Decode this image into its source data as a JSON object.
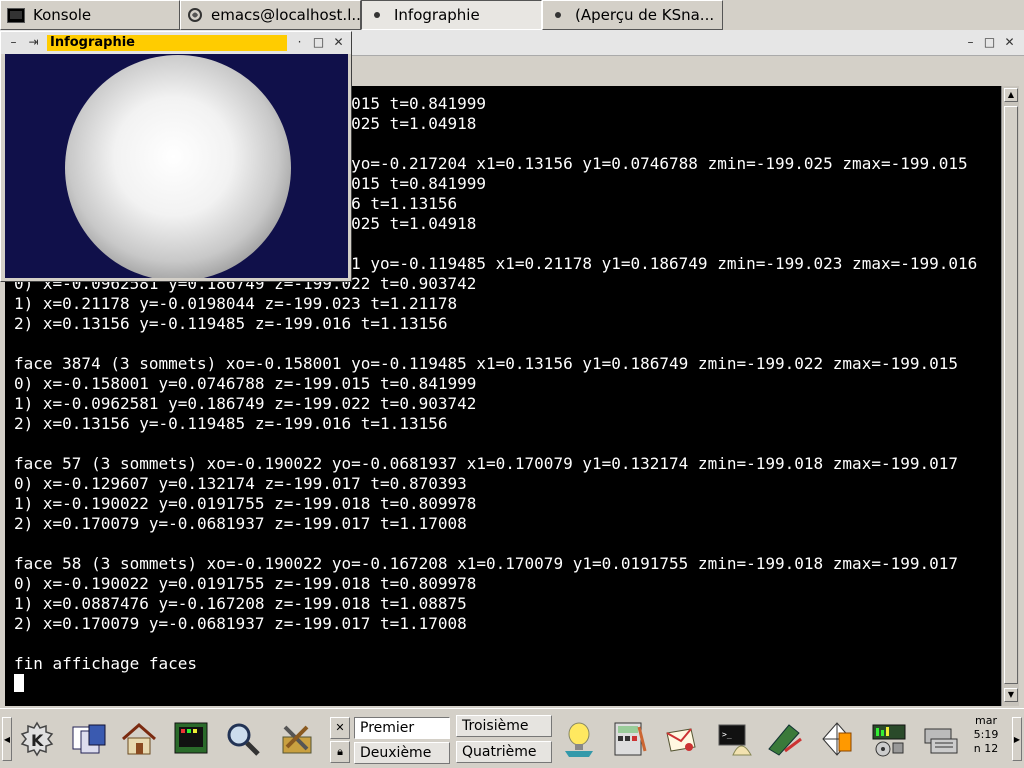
{
  "taskbar": {
    "tasks": [
      {
        "label": "Konsole",
        "icon": "konsole-icon",
        "active": false
      },
      {
        "label": "emacs@localhost.l...",
        "icon": "emacs-icon",
        "active": false
      },
      {
        "label": "Infographie",
        "icon": "app-dot-icon",
        "active": true
      },
      {
        "label": "(Aperçu de KSna...",
        "icon": "app-dot-icon",
        "active": false
      }
    ]
  },
  "infographie": {
    "title": "Infographie",
    "background_color": "#10104a"
  },
  "terminal": {
    "lines": [
      "                                   015 t=0.841999",
      "                                   025 t=1.04918",
      "",
      "                                   yo=-0.217204 x1=0.13156 y1=0.0746788 zmin=-199.025 zmax=-199.015",
      "                                   015 t=0.841999",
      "                                   6 t=1.13156",
      "                                   025 t=1.04918",
      "",
      "                                   1 yo=-0.119485 x1=0.21178 y1=0.186749 zmin=-199.023 zmax=-199.016",
      "0) x=-0.0962581 y=0.186749 z=-199.022 t=0.903742",
      "1) x=0.21178 y=-0.0198044 z=-199.023 t=1.21178",
      "2) x=0.13156 y=-0.119485 z=-199.016 t=1.13156",
      "",
      "face 3874 (3 sommets) xo=-0.158001 yo=-0.119485 x1=0.13156 y1=0.186749 zmin=-199.022 zmax=-199.015",
      "0) x=-0.158001 y=0.0746788 z=-199.015 t=0.841999",
      "1) x=-0.0962581 y=0.186749 z=-199.022 t=0.903742",
      "2) x=0.13156 y=-0.119485 z=-199.016 t=1.13156",
      "",
      "face 57 (3 sommets) xo=-0.190022 yo=-0.0681937 x1=0.170079 y1=0.132174 zmin=-199.018 zmax=-199.017",
      "0) x=-0.129607 y=0.132174 z=-199.017 t=0.870393",
      "1) x=-0.190022 y=0.0191755 z=-199.018 t=0.809978",
      "2) x=0.170079 y=-0.0681937 z=-199.017 t=1.17008",
      "",
      "face 58 (3 sommets) xo=-0.190022 yo=-0.167208 x1=0.170079 y1=0.0191755 zmin=-199.018 zmax=-199.017",
      "0) x=-0.190022 y=0.0191755 z=-199.018 t=0.809978",
      "1) x=0.0887476 y=-0.167208 z=-199.018 t=1.08875",
      "2) x=0.170079 y=-0.0681937 z=-199.017 t=1.17008",
      "",
      "fin affichage faces"
    ]
  },
  "panel": {
    "desktops": [
      "Premier",
      "Troisième",
      "Deuxième",
      "Quatrième"
    ],
    "clock": {
      "day": "mar",
      "time": "5:19",
      "date": "n 12"
    },
    "launchers": [
      "kde-menu-icon",
      "windows-list-icon",
      "home-icon",
      "terminal-app-icon",
      "search-icon",
      "tools-icon",
      "help-icon",
      "calculator-icon",
      "mail-icon",
      "shell-icon",
      "paint-icon",
      "vector-icon",
      "audio-mixer-icon",
      "network-icon"
    ]
  }
}
